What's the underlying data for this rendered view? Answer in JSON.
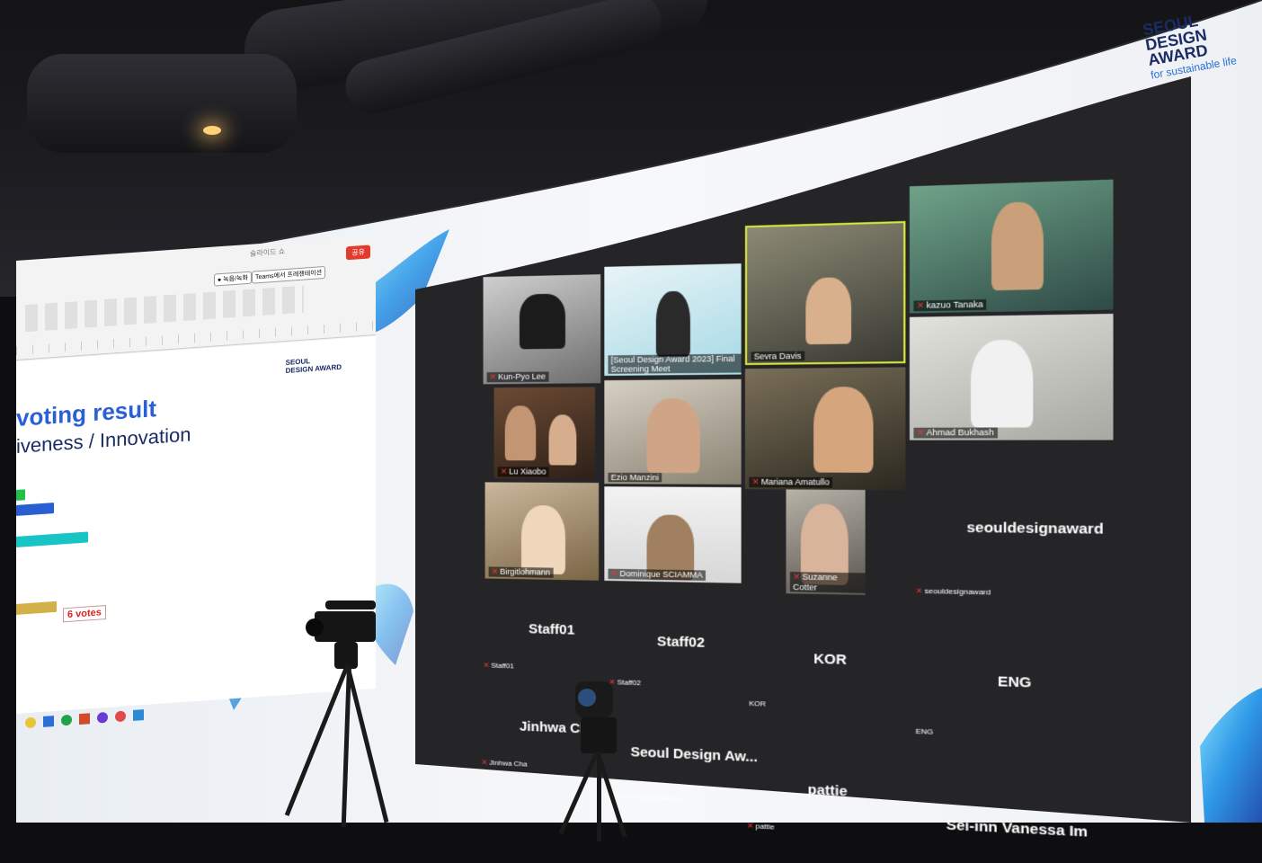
{
  "presentation": {
    "window_title": "슬라이드 쇼",
    "record_button": "● 녹음/녹화",
    "share_button": "Teams에서 프레젠테이션",
    "badge": "공유",
    "slide_title": "voting result",
    "slide_subtitle": "iveness / Innovation",
    "logo_line1": "SEOUL",
    "logo_line2": "DESIGN AWARD",
    "votes_label": "6 votes",
    "bar_colors": [
      "#22c04a",
      "#2a5fd2",
      "#18c4c4",
      "#d4b04a"
    ],
    "bar_values": [
      0.1,
      0.42,
      0.8,
      0.45
    ]
  },
  "brand": {
    "line1": "SEOUL",
    "line2": "DESIGN AWARD",
    "tagline": "for sustainable life"
  },
  "zoom": {
    "video_tiles": [
      {
        "name": "Kun-Pyo Lee"
      },
      {
        "name": "[Seoul Design Award 2023] Final Screening Meet"
      },
      {
        "name": "Sevra Davis"
      },
      {
        "name": "kazuo Tanaka"
      },
      {
        "name": "Lu Xiaobo"
      },
      {
        "name": "Ezio Manzini"
      },
      {
        "name": "Mariana Amatullo"
      },
      {
        "name": "Ahmad Bukhash"
      },
      {
        "name": "Birgitlohmann"
      },
      {
        "name": "Dominique SCIAMMA"
      },
      {
        "name": "Suzanne Cotter"
      }
    ],
    "name_tiles": [
      {
        "big": "seouldesignaward",
        "small": "seouldesignaward"
      },
      {
        "big": "Staff01",
        "small": "Staff01"
      },
      {
        "big": "Staff02",
        "small": "Staff02"
      },
      {
        "big": "KOR",
        "small": "KOR"
      },
      {
        "big": "ENG",
        "small": "ENG"
      },
      {
        "big": "Jinhwa Cha",
        "small": "Jinhwa Cha"
      },
      {
        "big": "Seoul Design Aw...",
        "small": "Seoul Design Award"
      },
      {
        "big": "pattie",
        "small": "pattie"
      },
      {
        "big": "Sei-inn Vanessa Im",
        "small": ""
      }
    ]
  }
}
